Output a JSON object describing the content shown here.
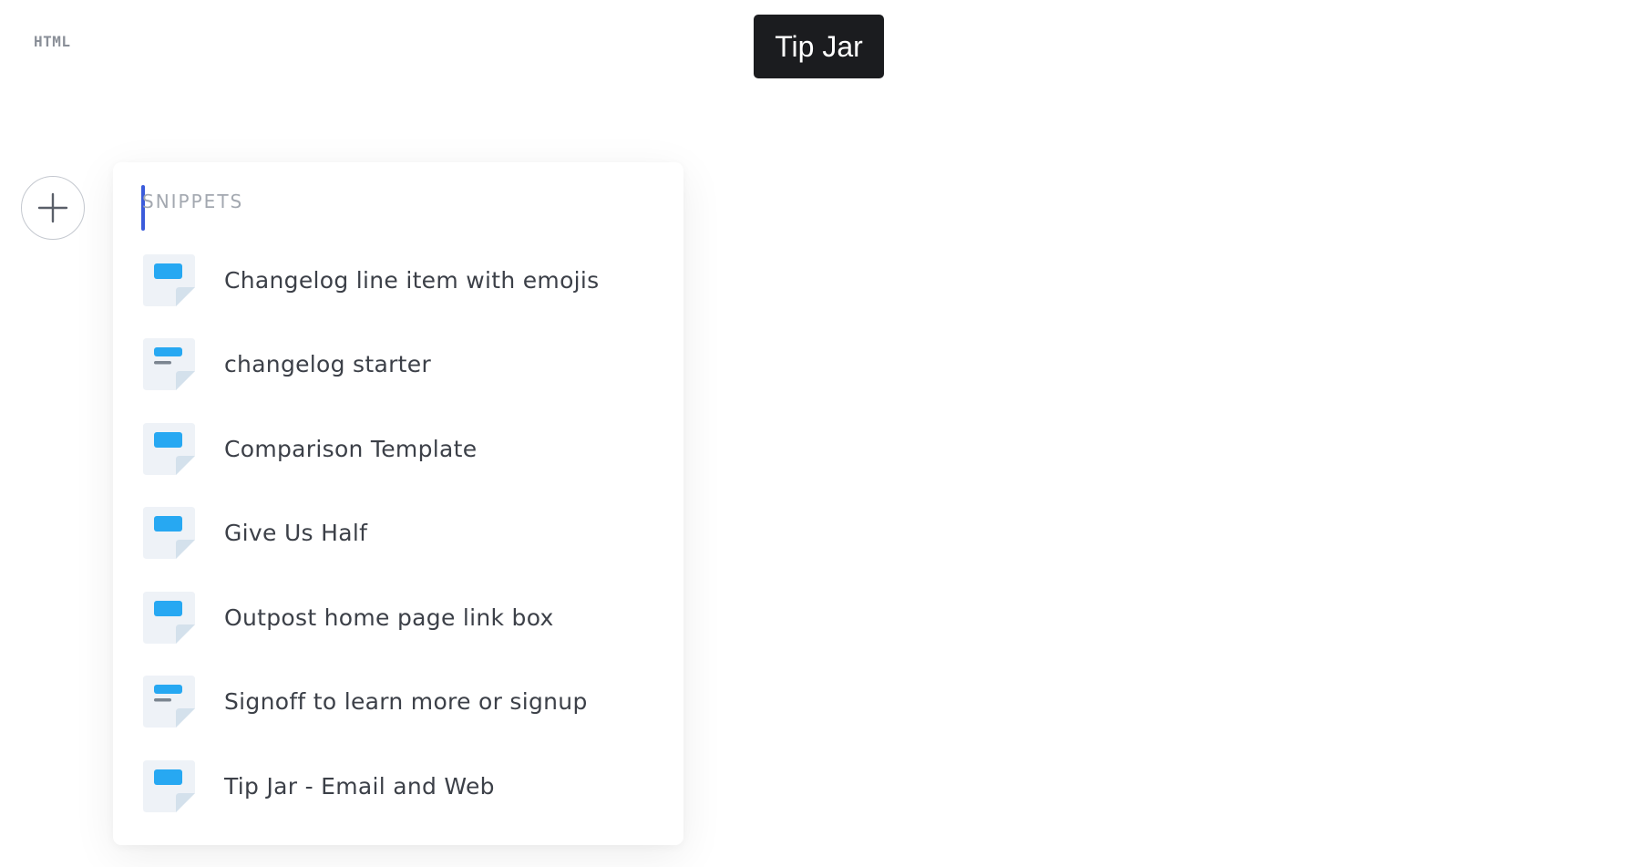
{
  "editor": {
    "language_label": "HTML",
    "title": "Tip Jar"
  },
  "insert_menu": {
    "add_button_icon": "plus-icon",
    "section_label": "SNIPPETS",
    "items": [
      {
        "label": "Changelog line item with emojis",
        "icon": "snippet-block-icon"
      },
      {
        "label": "changelog starter",
        "icon": "snippet-text-icon"
      },
      {
        "label": "Comparison Template",
        "icon": "snippet-block-icon"
      },
      {
        "label": "Give Us Half",
        "icon": "snippet-block-icon"
      },
      {
        "label": "Outpost home page link box",
        "icon": "snippet-block-icon"
      },
      {
        "label": "Signoff to learn more or signup",
        "icon": "snippet-text-icon"
      },
      {
        "label": "Tip Jar - Email and Web",
        "icon": "snippet-block-icon"
      }
    ]
  },
  "colors": {
    "accent": "#3b5bdb",
    "snippet_icon_blue": "#27a8f2",
    "title_tag_bg": "#1b1c1f"
  }
}
